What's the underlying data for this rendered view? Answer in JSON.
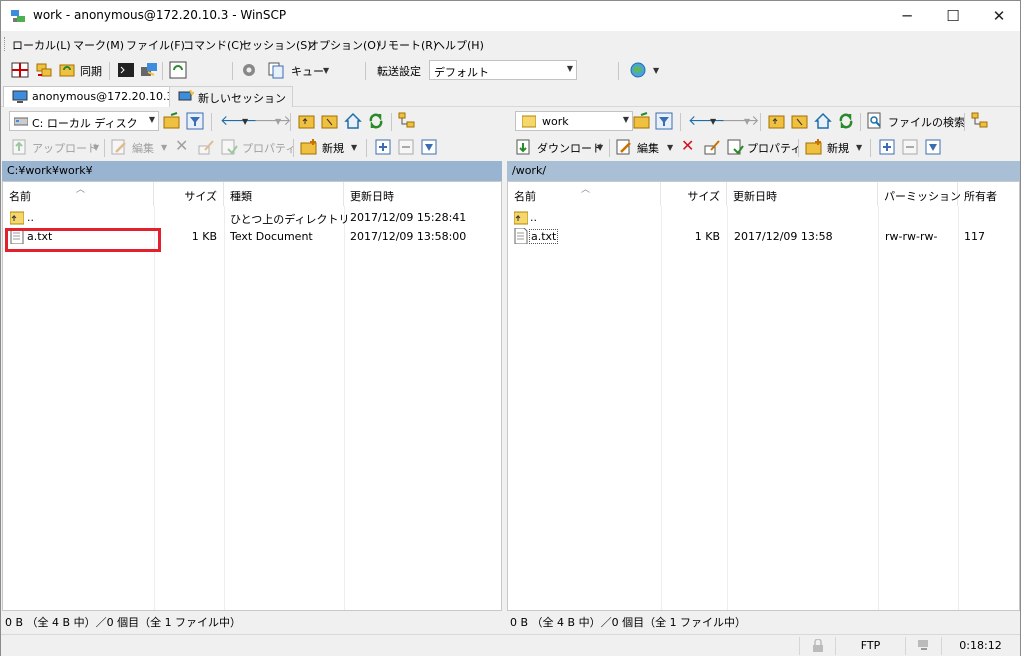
{
  "window": {
    "title": "work - anonymous@172.20.10.3 - WinSCP",
    "minimize": "─",
    "maximize": "☐",
    "close": "✕"
  },
  "menu": [
    "ローカル(L)",
    "マーク(M)",
    "ファイル(F)",
    "コマンド(C)",
    "セッション(S)",
    "オプション(O)",
    "リモート(R)",
    "ヘルプ(H)"
  ],
  "toolbar": {
    "sync_label": "同期",
    "queue_label": "キュー",
    "transfer_label": "転送設定",
    "transfer_value": "デフォルト"
  },
  "tabs": {
    "session": "anonymous@172.20.10.3",
    "new_session": "新しいセッション"
  },
  "local": {
    "drive": "C: ローカル ディスク",
    "upload": "アップロード",
    "edit": "編集",
    "properties": "プロパティ",
    "new": "新規",
    "path": "C:¥work¥work¥",
    "columns": {
      "name": "名前",
      "size": "サイズ",
      "type": "種類",
      "modified": "更新日時"
    },
    "files": [
      {
        "name": "..",
        "size": "",
        "type": "ひとつ上のディレクトリ",
        "modified": "2017/12/09  15:28:41"
      },
      {
        "name": "a.txt",
        "size": "1 KB",
        "type": "Text Document",
        "modified": "2017/12/09  13:58:00"
      }
    ],
    "status": "0 B （全 4 B 中）／0 個目（全 1 ファイル中）"
  },
  "remote": {
    "dir": "work",
    "find_files": "ファイルの検索",
    "download": "ダウンロード",
    "edit": "編集",
    "properties": "プロパティ",
    "new": "新規",
    "path": "/work/",
    "columns": {
      "name": "名前",
      "size": "サイズ",
      "modified": "更新日時",
      "perm": "パーミッション",
      "owner": "所有者"
    },
    "files": [
      {
        "name": "..",
        "size": "",
        "modified": "",
        "perm": "",
        "owner": ""
      },
      {
        "name": "a.txt",
        "size": "1 KB",
        "modified": "2017/12/09 13:58",
        "perm": "rw-rw-rw-",
        "owner": "117"
      }
    ],
    "status": "0 B （全 4 B 中）／0 個目（全 1 ファイル中）"
  },
  "statusbar": {
    "protocol": "FTP",
    "time": "0:18:12"
  },
  "colors": {
    "highlight": "#e3202c",
    "pathbar": "#99b4d1"
  }
}
